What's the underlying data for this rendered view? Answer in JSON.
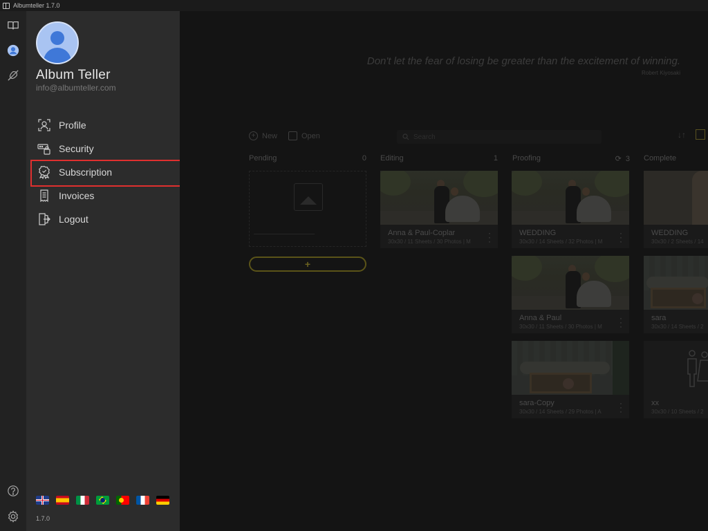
{
  "window": {
    "title": "Albumteller 1.7.0"
  },
  "rail": {
    "items": [
      {
        "icon": "album-book-icon"
      },
      {
        "icon": "user-account-icon"
      },
      {
        "icon": "rocket-off-icon"
      }
    ],
    "bottom": [
      {
        "icon": "help-icon"
      },
      {
        "icon": "settings-gear-icon"
      }
    ]
  },
  "account": {
    "name": "Album Teller",
    "email": "info@albumteller.com",
    "menu": [
      {
        "label": "Profile",
        "icon": "face-scan-icon"
      },
      {
        "label": "Security",
        "icon": "security-lock-icon"
      },
      {
        "label": "Subscription",
        "icon": "award-badge-icon"
      },
      {
        "label": "Invoices",
        "icon": "invoice-document-icon"
      },
      {
        "label": "Logout",
        "icon": "logout-door-icon"
      }
    ],
    "languages": [
      "en-GB",
      "es",
      "it",
      "pt-BR",
      "pt",
      "fr",
      "de"
    ],
    "version": "1.7.0"
  },
  "main": {
    "quote": "Don't let the fear of losing be greater than the excitement of winning.",
    "quote_author": "Robert Kiyosaki",
    "toolbar": {
      "new_label": "New",
      "open_label": "Open",
      "search_placeholder": "Search"
    },
    "columns": [
      {
        "name": "Pending",
        "count": "0"
      },
      {
        "name": "Editing",
        "count": "1"
      },
      {
        "name": "Proofing",
        "count": "3"
      },
      {
        "name": "Complete",
        "count": ""
      }
    ],
    "add_label": "+",
    "cards": {
      "editing": [
        {
          "title": "Anna & Paul-Coplar",
          "meta": "30x30 / 11 Sheets / 30 Photos | M"
        }
      ],
      "proofing": [
        {
          "title": "WEDDING",
          "meta": "30x30 / 14 Sheets / 32 Photos | M"
        },
        {
          "title": "Anna & Paul",
          "meta": "30x30 / 11 Sheets / 30 Photos | M"
        },
        {
          "title": "sara-Copy",
          "meta": "30x30 / 14 Sheets / 29 Photos | A"
        }
      ],
      "complete": [
        {
          "title": "WEDDING",
          "meta": "30x30 / 2 Sheets / 14"
        },
        {
          "title": "sara",
          "meta": "30x30 / 14 Sheets / 2"
        },
        {
          "title": "xx",
          "meta": "30x30 / 10 Sheets / 2"
        }
      ]
    }
  },
  "colors": {
    "accent": "#e0302f",
    "gold": "#6b621f",
    "avatar": "#3f78d8"
  }
}
